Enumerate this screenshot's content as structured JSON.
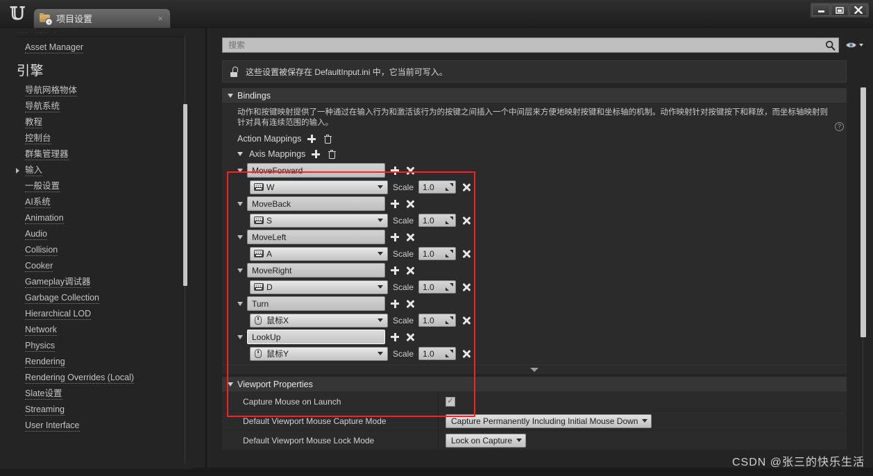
{
  "window": {
    "tab_title": "项目设置",
    "tab_close": "×",
    "minimize": "minimize",
    "maximize": "maximize",
    "close": "close"
  },
  "sidebar": {
    "clipped_top_label": "游戏人",
    "top_item": "Asset Manager",
    "group_title": "引擎",
    "items": [
      {
        "label": "导航网格物体",
        "expandable": false
      },
      {
        "label": "导航系统",
        "expandable": false
      },
      {
        "label": "教程",
        "expandable": false
      },
      {
        "label": "控制台",
        "expandable": false
      },
      {
        "label": "群集管理器",
        "expandable": false
      },
      {
        "label": "输入",
        "expandable": true
      },
      {
        "label": "一般设置",
        "expandable": false
      },
      {
        "label": "AI系统",
        "expandable": false
      },
      {
        "label": "Animation",
        "expandable": false
      },
      {
        "label": "Audio",
        "expandable": false
      },
      {
        "label": "Collision",
        "expandable": false
      },
      {
        "label": "Cooker",
        "expandable": false
      },
      {
        "label": "Gameplay调试器",
        "expandable": false
      },
      {
        "label": "Garbage Collection",
        "expandable": false
      },
      {
        "label": "Hierarchical LOD",
        "expandable": false
      },
      {
        "label": "Network",
        "expandable": false
      },
      {
        "label": "Physics",
        "expandable": false
      },
      {
        "label": "Rendering",
        "expandable": false
      },
      {
        "label": "Rendering Overrides (Local)",
        "expandable": false
      },
      {
        "label": "Slate设置",
        "expandable": false
      },
      {
        "label": "Streaming",
        "expandable": false
      },
      {
        "label": "User Interface",
        "expandable": false
      }
    ]
  },
  "search": {
    "placeholder": "搜索",
    "value": ""
  },
  "notice": {
    "text": "这些设置被保存在 DefaultInput.ini 中，它当前可写入。"
  },
  "bindings": {
    "title": "Bindings",
    "description": "动作和按键映射提供了一种通过在输入行为和激活该行为的按键之间插入一个中间层来方便地映射按键和坐标轴的机制。动作映射针对按键按下和释放，而坐标轴映射则针对具有连续范围的输入。",
    "help": "?",
    "action_mappings": {
      "label": "Action Mappings",
      "add": "+",
      "delete": "delete"
    },
    "axis_mappings": {
      "label": "Axis Mappings",
      "add": "+",
      "delete": "delete",
      "scale_label": "Scale",
      "entries": [
        {
          "name": "MoveForward",
          "focused": false,
          "key": "W",
          "key_device": "keyboard",
          "scale": "1.0"
        },
        {
          "name": "MoveBack",
          "focused": false,
          "key": "S",
          "key_device": "keyboard",
          "scale": "1.0"
        },
        {
          "name": "MoveLeft",
          "focused": false,
          "key": "A",
          "key_device": "keyboard",
          "scale": "1.0"
        },
        {
          "name": "MoveRight",
          "focused": false,
          "key": "D",
          "key_device": "keyboard",
          "scale": "1.0"
        },
        {
          "name": "Turn",
          "focused": false,
          "key": "鼠标X",
          "key_device": "mouse",
          "scale": "1.0"
        },
        {
          "name": "LookUp",
          "focused": true,
          "key": "鼠标Y",
          "key_device": "mouse",
          "scale": "1.0"
        }
      ]
    }
  },
  "viewport": {
    "title": "Viewport Properties",
    "rows": [
      {
        "label": "Capture Mouse on Launch",
        "type": "checkbox",
        "checked": true,
        "check_glyph": "✓"
      },
      {
        "label": "Default Viewport Mouse Capture Mode",
        "type": "combo",
        "value": "Capture Permanently Including Initial Mouse Down"
      },
      {
        "label": "Default Viewport Mouse Lock Mode",
        "type": "combo",
        "value": "Lock on Capture"
      }
    ]
  },
  "watermark": "CSDN @张三的快乐生活",
  "colors": {
    "highlight_box": "#ff2020",
    "panel_bg": "#242424",
    "section_bg": "#2b2b2b",
    "field_light": "#c8c8c8"
  }
}
